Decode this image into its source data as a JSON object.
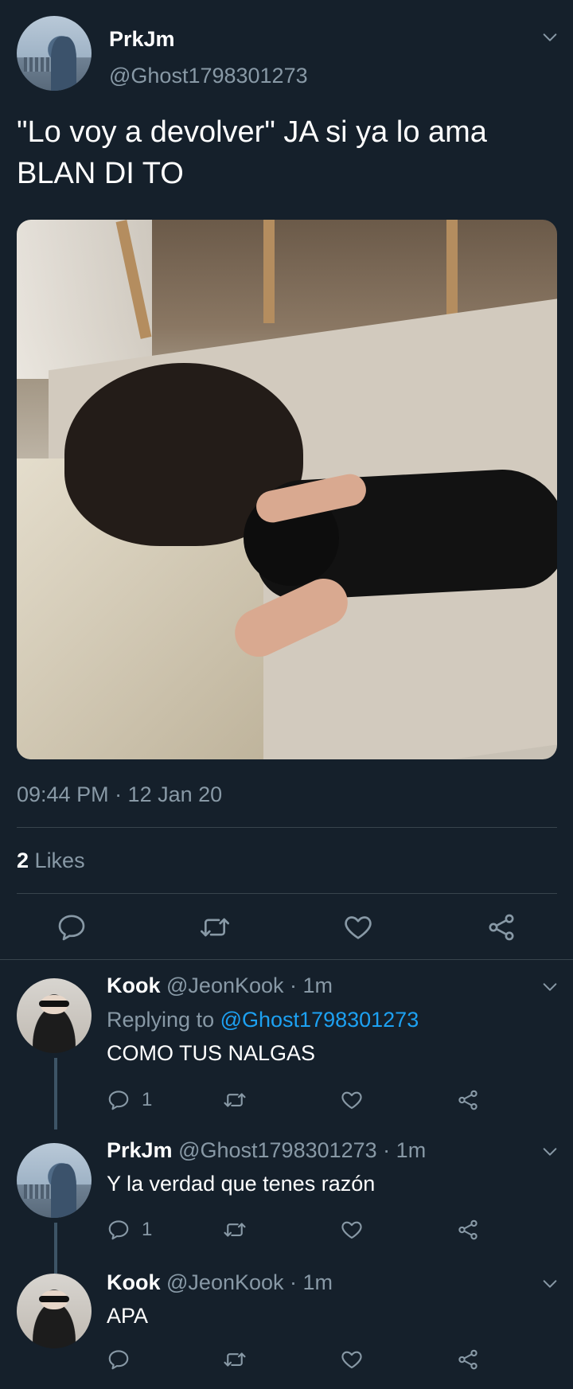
{
  "main_tweet": {
    "name": "PrkJm",
    "handle": "@Ghost1798301273",
    "text_line1": "\"Lo voy a devolver\" JA si ya lo ama",
    "text_line2": "BLAN DI TO",
    "timestamp": "09:44 PM · 12 Jan 20",
    "likes_count": "2",
    "likes_label": "Likes"
  },
  "replies": [
    {
      "name": "Kook",
      "handle_time": "@JeonKook · 1m",
      "replying_prefix": "Replying to",
      "replying_to": "@Ghost1798301273",
      "text": "COMO TUS NALGAS",
      "reply_count": "1"
    },
    {
      "name": "PrkJm",
      "handle_time": "@Ghost1798301273 · 1m",
      "text": "Y la verdad que tenes razón",
      "reply_count": "1"
    },
    {
      "name": "Kook",
      "handle_time": "@JeonKook · 1m",
      "text": "APA"
    }
  ],
  "icons": {
    "reply": "reply-icon",
    "retweet": "retweet-icon",
    "like": "heart-icon",
    "share": "share-icon",
    "more": "chevron-down-icon"
  },
  "colors": {
    "background": "#15202b",
    "muted": "#8899a6",
    "link": "#1da1f2",
    "divider": "#38444d"
  }
}
